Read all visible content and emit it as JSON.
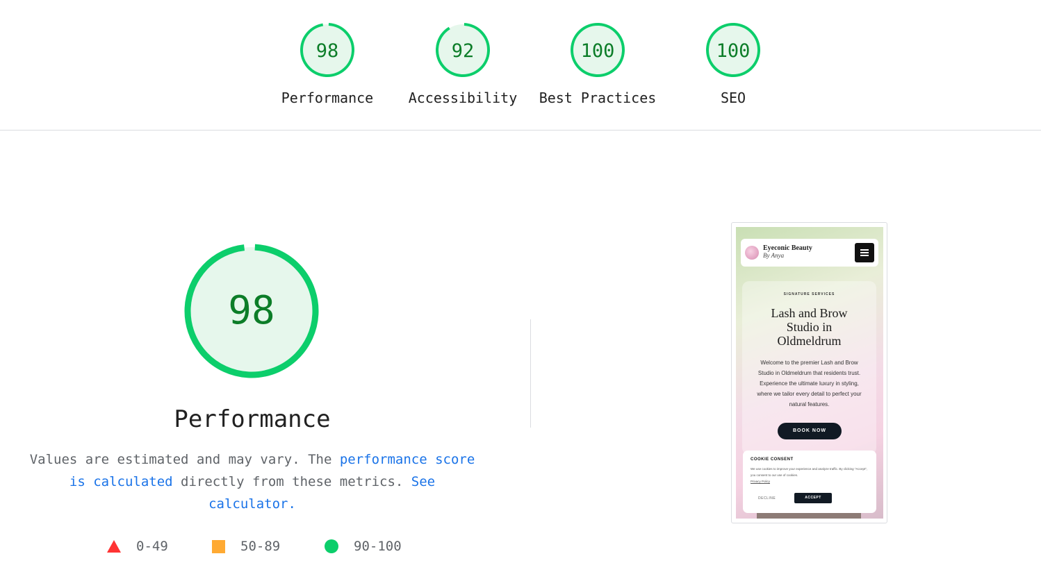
{
  "gauges": [
    {
      "score": "98",
      "label": "Performance",
      "fraction": 0.98
    },
    {
      "score": "92",
      "label": "Accessibility",
      "fraction": 0.92
    },
    {
      "score": "100",
      "label": "Best Practices",
      "fraction": 1.0
    },
    {
      "score": "100",
      "label": "SEO",
      "fraction": 1.0
    }
  ],
  "colors": {
    "pass": "#0cce6b",
    "pass_text": "#0c7d28",
    "pass_fill": "#e6f7ec",
    "average": "#ffaa33",
    "fail": "#ff3333",
    "link": "#1a73e8"
  },
  "performance": {
    "score": "98",
    "fraction": 0.98,
    "title": "Performance",
    "desc_start": "Values are estimated and may vary. The ",
    "desc_link1": "performance score is calculated",
    "desc_middle": " directly from these metrics.",
    "desc_link2": "See calculator.",
    "legend": [
      {
        "icon": "triangle-fail-icon",
        "range": "0-49"
      },
      {
        "icon": "square-average-icon",
        "range": "50-89"
      },
      {
        "icon": "circle-pass-icon",
        "range": "90-100"
      }
    ]
  },
  "thumbnail": {
    "brand": "Eyeconic Beauty",
    "brand_sub": "By Anya",
    "eyebrow": "SIGNATURE SERVICES",
    "title_line1": "Lash and Brow",
    "title_line2": "Studio in",
    "title_line3": "Oldmeldrum",
    "body": "Welcome to the premier Lash and Brow Studio in Oldmeldrum that residents trust. Experience the ultimate luxury in styling, where we tailor every detail to perfect your natural features.",
    "book_button": "BOOK NOW",
    "cookie_title": "COOKIE CONSENT",
    "cookie_text": "We use cookies to improve your experience and analyze traffic. By clicking \"Accept\", you consent to our use of cookies.",
    "cookie_link": "Privacy Policy",
    "decline": "DECLINE",
    "accept": "ACCEPT"
  }
}
